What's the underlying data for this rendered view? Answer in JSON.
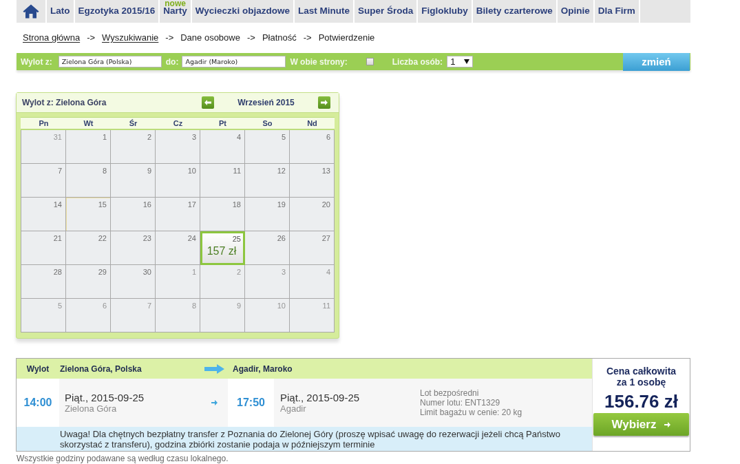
{
  "nav": {
    "items": [
      {
        "label": "Lato"
      },
      {
        "label": "Egzotyka 2015/16"
      },
      {
        "label": "Narty",
        "badge": "nowe"
      },
      {
        "label": "Wycieczki objazdowe"
      },
      {
        "label": "Last Minute"
      },
      {
        "label": "Super Środa"
      },
      {
        "label": "Figlokluby"
      },
      {
        "label": "Bilety czarterowe"
      },
      {
        "label": "Opinie"
      },
      {
        "label": "Dla Firm"
      }
    ]
  },
  "breadcrumb": [
    {
      "kind": "link",
      "label": "Strona główna"
    },
    {
      "kind": "separator",
      "label": "->"
    },
    {
      "kind": "link",
      "label": "Wyszukiwanie"
    },
    {
      "kind": "separator",
      "label": "->"
    },
    {
      "kind": "step",
      "label": "Dane osobowe"
    },
    {
      "kind": "separator",
      "label": "->"
    },
    {
      "kind": "step",
      "label": "Płatność"
    },
    {
      "kind": "separator",
      "label": "->"
    },
    {
      "kind": "step",
      "label": "Potwierdzenie"
    }
  ],
  "search": {
    "from": {
      "label": "Wylot z:",
      "value": "Zielona Góra (Polska)"
    },
    "to": {
      "label": "do:",
      "value": "Agadir (Maroko)"
    },
    "round_trip": {
      "label": "W obie strony:",
      "checked": false
    },
    "persons": {
      "label": "Liczba osób:",
      "value": "1"
    },
    "submit": "zmień"
  },
  "calendar": {
    "title": "Wylot z: Zielona Góra",
    "month": "Wrzesień 2015",
    "weekdays": [
      "Pn",
      "Wt",
      "Śr",
      "Cz",
      "Pt",
      "So",
      "Nd"
    ],
    "days": [
      {
        "day": "31",
        "outside": true,
        "selected": false,
        "today": false
      },
      {
        "day": "1",
        "outside": false,
        "selected": false,
        "today": false
      },
      {
        "day": "2",
        "outside": false,
        "selected": false,
        "today": false
      },
      {
        "day": "3",
        "outside": false,
        "selected": false,
        "today": false
      },
      {
        "day": "4",
        "outside": false,
        "selected": false,
        "today": false
      },
      {
        "day": "5",
        "outside": false,
        "selected": false,
        "today": false
      },
      {
        "day": "6",
        "outside": false,
        "selected": false,
        "today": false
      },
      {
        "day": "7",
        "outside": false,
        "selected": false,
        "today": false
      },
      {
        "day": "8",
        "outside": false,
        "selected": false,
        "today": false
      },
      {
        "day": "9",
        "outside": false,
        "selected": false,
        "today": false
      },
      {
        "day": "10",
        "outside": false,
        "selected": false,
        "today": false
      },
      {
        "day": "11",
        "outside": false,
        "selected": false,
        "today": false
      },
      {
        "day": "12",
        "outside": false,
        "selected": false,
        "today": false
      },
      {
        "day": "13",
        "outside": false,
        "selected": false,
        "today": false
      },
      {
        "day": "14",
        "outside": false,
        "selected": false,
        "today": false
      },
      {
        "day": "15",
        "outside": false,
        "selected": false,
        "today": true
      },
      {
        "day": "16",
        "outside": false,
        "selected": false,
        "today": false
      },
      {
        "day": "17",
        "outside": false,
        "selected": false,
        "today": false
      },
      {
        "day": "18",
        "outside": false,
        "selected": false,
        "today": false
      },
      {
        "day": "19",
        "outside": false,
        "selected": false,
        "today": false
      },
      {
        "day": "20",
        "outside": false,
        "selected": false,
        "today": false
      },
      {
        "day": "21",
        "outside": false,
        "selected": false,
        "today": false
      },
      {
        "day": "22",
        "outside": false,
        "selected": false,
        "today": false
      },
      {
        "day": "23",
        "outside": false,
        "selected": false,
        "today": false
      },
      {
        "day": "24",
        "outside": false,
        "selected": false,
        "today": false
      },
      {
        "day": "25",
        "outside": false,
        "selected": true,
        "today": false,
        "price": "157 zł"
      },
      {
        "day": "26",
        "outside": false,
        "selected": false,
        "today": false
      },
      {
        "day": "27",
        "outside": false,
        "selected": false,
        "today": false
      },
      {
        "day": "28",
        "outside": false,
        "selected": false,
        "today": false
      },
      {
        "day": "29",
        "outside": false,
        "selected": false,
        "today": false
      },
      {
        "day": "30",
        "outside": false,
        "selected": false,
        "today": false
      },
      {
        "day": "1",
        "outside": true,
        "selected": false,
        "today": false
      },
      {
        "day": "2",
        "outside": true,
        "selected": false,
        "today": false
      },
      {
        "day": "3",
        "outside": true,
        "selected": false,
        "today": false
      },
      {
        "day": "4",
        "outside": true,
        "selected": false,
        "today": false
      },
      {
        "day": "5",
        "outside": true,
        "selected": false,
        "today": false
      },
      {
        "day": "6",
        "outside": true,
        "selected": false,
        "today": false
      },
      {
        "day": "7",
        "outside": true,
        "selected": false,
        "today": false
      },
      {
        "day": "8",
        "outside": true,
        "selected": false,
        "today": false
      },
      {
        "day": "9",
        "outside": true,
        "selected": false,
        "today": false
      },
      {
        "day": "10",
        "outside": true,
        "selected": false,
        "today": false
      },
      {
        "day": "11",
        "outside": true,
        "selected": false,
        "today": false
      }
    ]
  },
  "flight": {
    "header": {
      "label": "Wylot",
      "from": "Zielona Góra, Polska",
      "to": "Agadir, Maroko"
    },
    "departure": {
      "time": "14:00",
      "date": "Piąt., 2015-09-25",
      "city": "Zielona Góra"
    },
    "arrival": {
      "time": "17:50",
      "date": "Piąt., 2015-09-25",
      "city": "Agadir"
    },
    "details": [
      "Lot bezpośredni",
      "Numer lotu: ENT1329",
      "Limit bagażu w cenie: 20 kg"
    ],
    "note": "Uwaga! Dla chętnych bezpłatny transfer z Poznania do Zielonej Góry (proszę wpisać uwagę do rezerwacji jeżeli chcą Państwo skorzystać z transferu), godzina zbiórki zostanie podaja w późniejszym terminie",
    "price": {
      "label": "Cena całkowita za 1 osobę",
      "amount": "156.76 zł",
      "button": "Wybierz"
    }
  },
  "footer": "Wszystkie godziny podawane są według czasu lokalnego."
}
